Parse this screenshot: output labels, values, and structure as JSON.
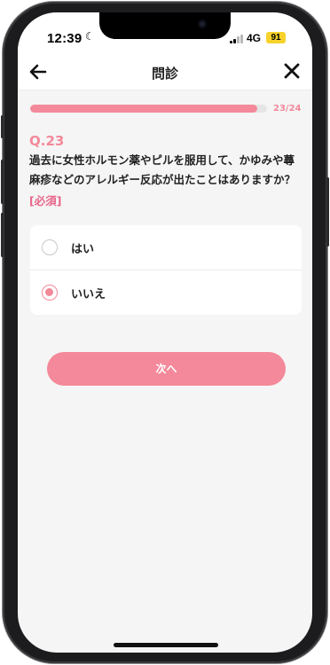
{
  "status_bar": {
    "time": "12:39",
    "network": "4G",
    "battery": "91"
  },
  "header": {
    "title": "問診"
  },
  "progress": {
    "text": "23/24",
    "fraction": 0.958,
    "color": "#f3899a"
  },
  "question": {
    "number": "Q.23",
    "text": "過去に女性ホルモン薬やピルを服用して、かゆみや蕁麻疹などのアレルギー反応が出たことはありますか？",
    "required": "[必須]"
  },
  "options": [
    {
      "label": "はい",
      "selected": false
    },
    {
      "label": "いいえ",
      "selected": true
    }
  ],
  "next_button": {
    "label": "次へ"
  },
  "colors": {
    "accent": "#f3899a",
    "required": "#e8668a",
    "battery": "#f6d22b"
  }
}
